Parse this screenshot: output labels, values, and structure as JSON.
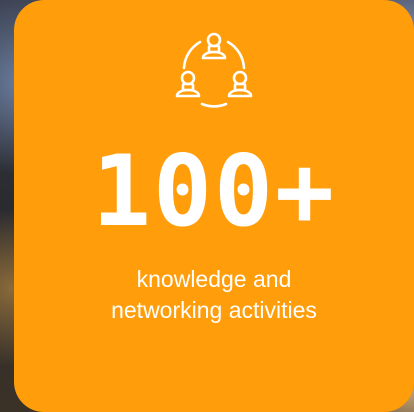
{
  "card": {
    "icon": "people-network-icon",
    "stat_value": "100+",
    "caption_line1": "knowledge and",
    "caption_line2": "networking activities",
    "background_color": "#ff9d0a",
    "text_color": "#ffffff"
  }
}
